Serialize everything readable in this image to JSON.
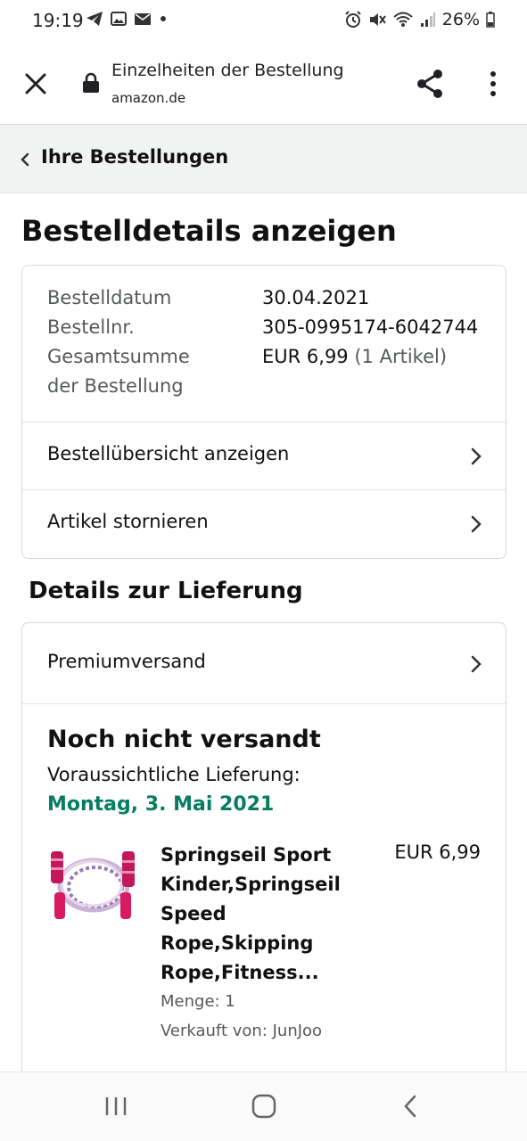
{
  "status_bar": {
    "time": "19:19",
    "battery": "26%"
  },
  "browser": {
    "title": "Einzelheiten der Bestellung",
    "url": "amazon.de"
  },
  "back_link": {
    "label": "Ihre Bestellungen"
  },
  "page_title": "Bestelldetails anzeigen",
  "order_info": {
    "date_label": "Bestelldatum",
    "date_value": "30.04.2021",
    "number_label": "Bestellnr.",
    "number_value": "305-0995174-6042744",
    "total_label_line1": "Gesamtsumme",
    "total_label_line2": "der Bestellung",
    "total_value": "EUR 6,99",
    "total_items": "(1 Artikel)"
  },
  "order_links": [
    {
      "label": "Bestellübersicht anzeigen"
    },
    {
      "label": "Artikel stornieren"
    }
  ],
  "delivery": {
    "section_title": "Details zur Lieferung",
    "shipping_method": "Premiumversand",
    "status": "Noch nicht versandt",
    "expected_label": "Voraussichtliche Lieferung:",
    "expected_date": "Montag, 3. Mai 2021",
    "product": {
      "name_lines": [
        "Springseil Sport",
        "Kinder,Springseil",
        "Speed",
        "Rope,Skipping",
        "Rope,Fitness..."
      ],
      "price": "EUR 6,99",
      "quantity": "Menge: 1",
      "seller": "Verkauft von: JunJoo"
    }
  },
  "colors": {
    "delivery_date": "#067d62",
    "back_bar_bg": "#f1f2f2",
    "border": "#d5d9d9",
    "product_handle": "#c2185b"
  }
}
